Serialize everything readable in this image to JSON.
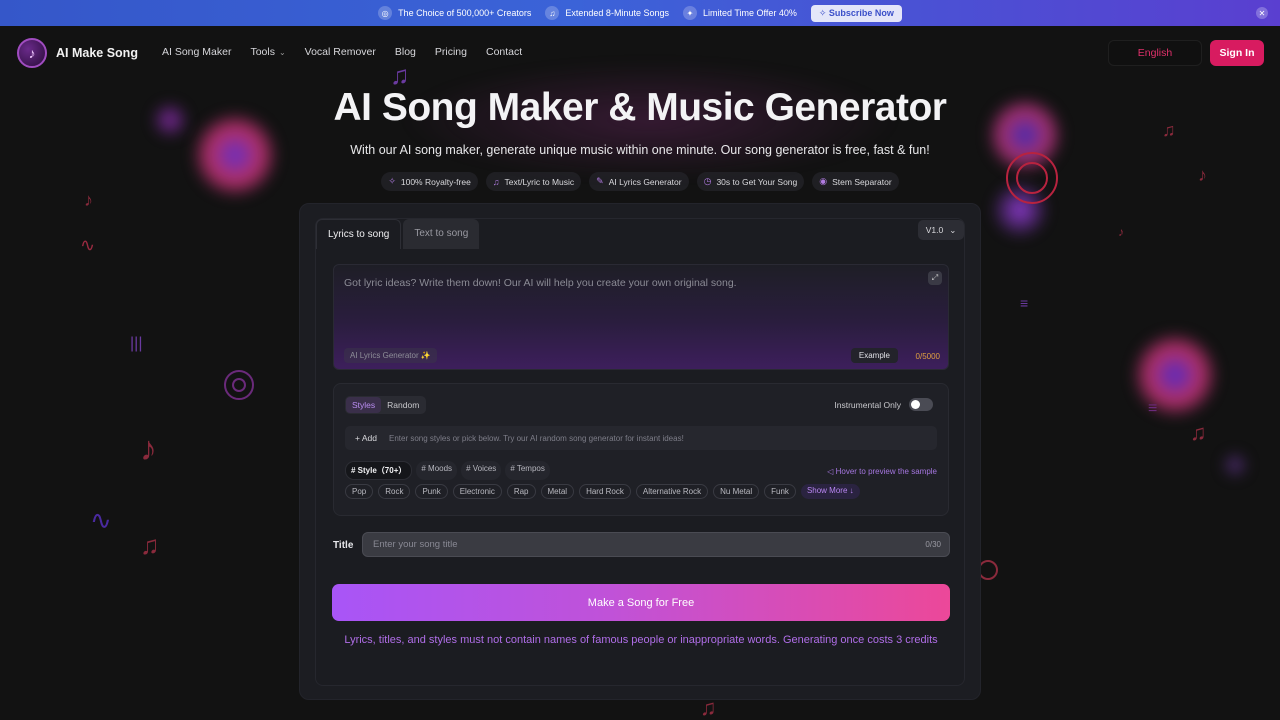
{
  "promo": {
    "items": [
      {
        "icon": "badge-icon",
        "text": "The Choice of 500,000+ Creators"
      },
      {
        "icon": "music-note-icon",
        "text": "Extended 8-Minute Songs"
      },
      {
        "icon": "offer-icon",
        "text": "Limited Time Offer 40%"
      }
    ],
    "subscribe_label": "Subscribe Now"
  },
  "nav": {
    "brand": "AI Make Song",
    "links": [
      "AI Song Maker",
      "Tools",
      "Vocal Remover",
      "Blog",
      "Pricing",
      "Contact"
    ],
    "language": "English",
    "signin": "Sign In"
  },
  "hero": {
    "title": "AI Song Maker & Music Generator",
    "subtitle": "With our AI song maker, generate unique music within one minute. Our song generator is free, fast & fun!",
    "features": [
      {
        "icon": "sparkle-icon",
        "text": "100% Royalty-free"
      },
      {
        "icon": "music-note-icon",
        "text": "Text/Lyric to Music"
      },
      {
        "icon": "pen-icon",
        "text": "AI Lyrics Generator"
      },
      {
        "icon": "timer-icon",
        "text": "30s to Get Your Song"
      },
      {
        "icon": "separator-icon",
        "text": "Stem Separator"
      }
    ]
  },
  "generator": {
    "tabs": [
      "Lyrics to song",
      "Text to song"
    ],
    "version": "V1.0",
    "lyrics_placeholder": "Got lyric ideas? Write them down! Our AI will help you create your own original song.",
    "ai_lyrics_button": "AI Lyrics Generator ✨",
    "example_button": "Example",
    "lyrics_counter": "0/5000",
    "style_modes": [
      "Styles",
      "Random"
    ],
    "instrumental_label": "Instrumental Only",
    "add_label": "+ Add",
    "style_placeholder": "Enter song styles or pick below. Try our AI random song generator for instant ideas!",
    "categories": [
      "# Style（70+）",
      "# Moods",
      "# Voices",
      "# Tempos"
    ],
    "hover_tip": "Hover to preview the sample",
    "chips": [
      "Pop",
      "Rock",
      "Punk",
      "Electronic",
      "Rap",
      "Metal",
      "Hard Rock",
      "Alternative Rock",
      "Nu Metal",
      "Funk"
    ],
    "show_more": "Show More ↓",
    "title_label": "Title",
    "title_placeholder": "Enter your song title",
    "title_counter": "0/30",
    "make_button": "Make a Song for Free",
    "notice": "Lyrics, titles, and styles must not contain names of famous people or inappropriate words. Generating once costs 3 credits"
  },
  "colors": {
    "accent": "#d81b60",
    "button_gradient_start": "#a855f7",
    "button_gradient_end": "#ec4899",
    "promo_bar": "#3b63d8"
  }
}
